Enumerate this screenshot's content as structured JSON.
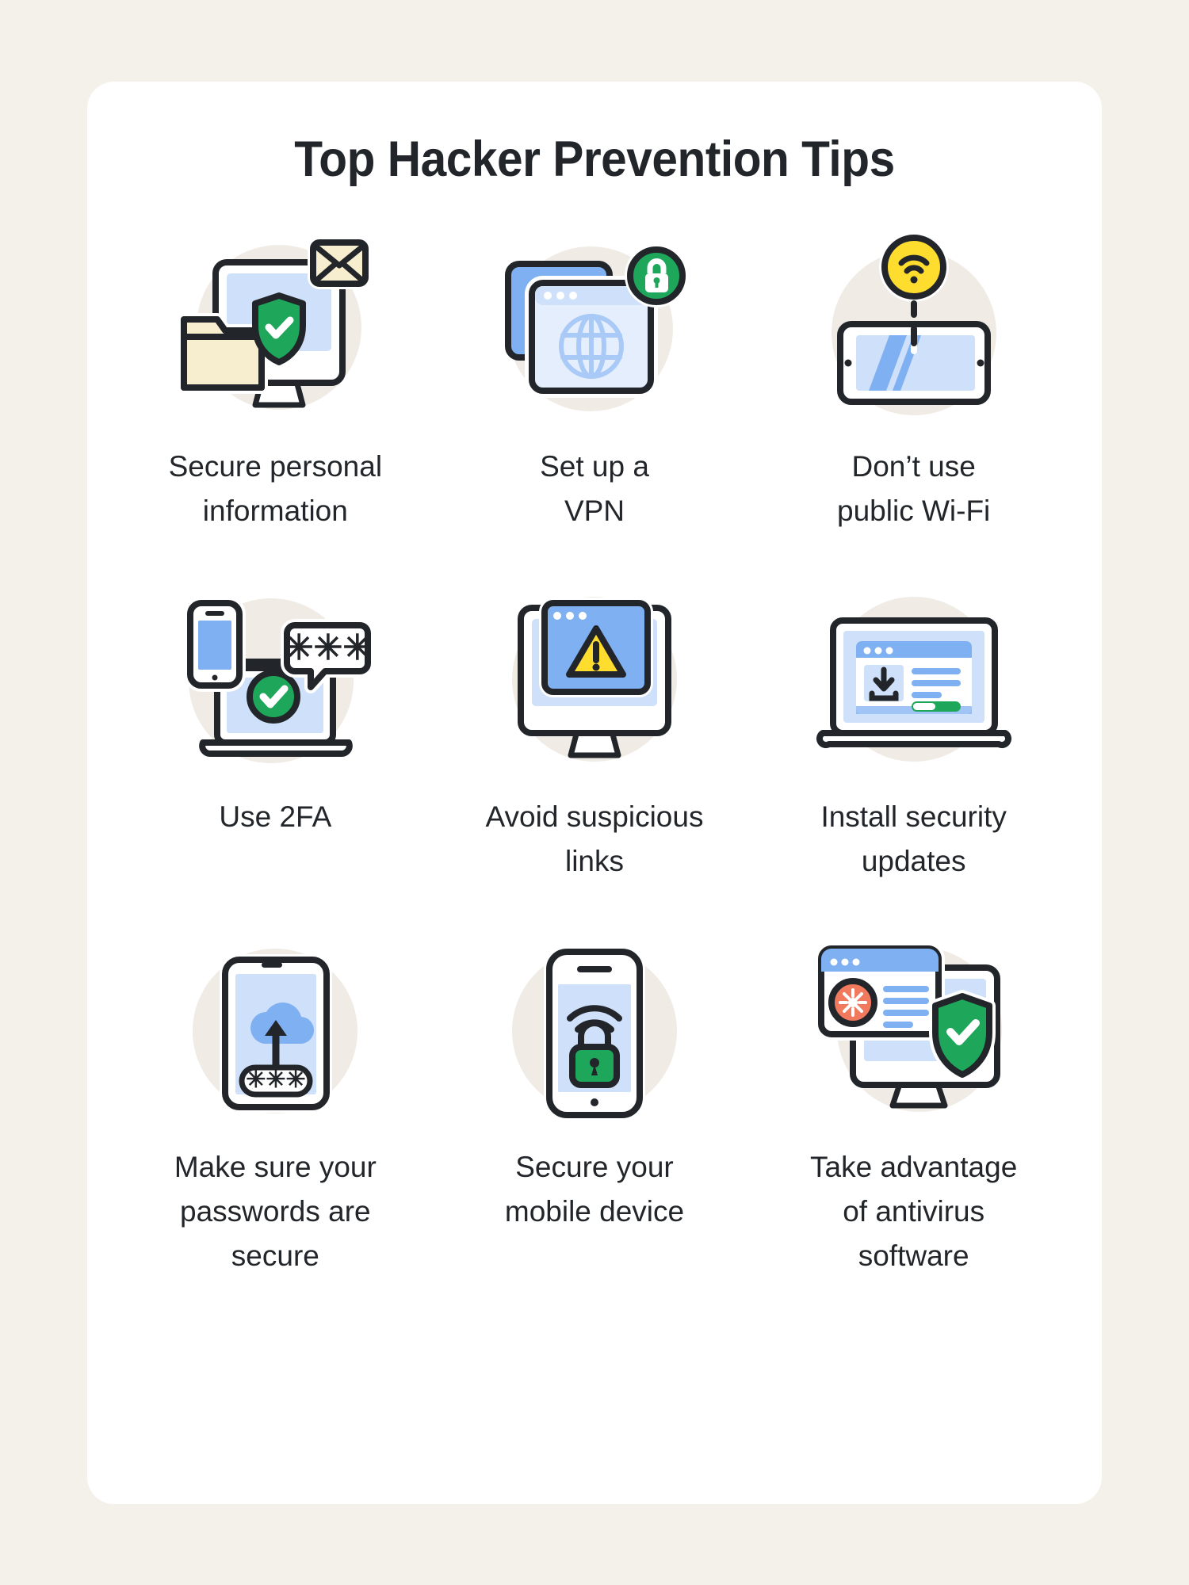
{
  "page": {
    "background_color": "#f4f1ea",
    "card_color": "#ffffff",
    "title": "Top Hacker Prevention Tips"
  },
  "palette": {
    "ink": "#22262a",
    "green": "#1ea75a",
    "green_dark": "#199a52",
    "blue_mid": "#7fb0f2",
    "blue_light": "#cfe0fa",
    "blue_pale": "#e4eefc",
    "yellow": "#ffdd2e",
    "cream": "#f7eecf",
    "orange": "#f0795e",
    "circle_bg": "#f0ece5",
    "white": "#ffffff"
  },
  "tips": [
    {
      "id": "secure-personal-information",
      "icon": "monitor-folder-shield-mail-icon",
      "label": "Secure personal\ninformation"
    },
    {
      "id": "set-up-a-vpn",
      "icon": "browser-windows-globe-lock-icon",
      "label": "Set up a\nVPN"
    },
    {
      "id": "dont-use-public-wifi",
      "icon": "phone-wifi-warning-icon",
      "label": "Don’t use\npublic Wi-Fi"
    },
    {
      "id": "use-2fa",
      "icon": "laptop-phone-checkmark-passcode-icon",
      "label": "Use 2FA"
    },
    {
      "id": "avoid-suspicious-links",
      "icon": "monitor-warning-triangle-icon",
      "label": "Avoid suspicious\nlinks"
    },
    {
      "id": "install-security-updates",
      "icon": "laptop-download-progress-icon",
      "label": "Install security\nupdates"
    },
    {
      "id": "make-sure-passwords-secure",
      "icon": "tablet-cloud-upload-password-icon",
      "label": "Make sure your\npasswords are\nsecure"
    },
    {
      "id": "secure-your-mobile-device",
      "icon": "phone-wifi-padlock-icon",
      "label": "Secure your\nmobile device"
    },
    {
      "id": "take-advantage-of-antivirus-software",
      "icon": "monitor-virus-scan-shield-icon",
      "label": "Take advantage\nof antivirus\nsoftware"
    }
  ]
}
